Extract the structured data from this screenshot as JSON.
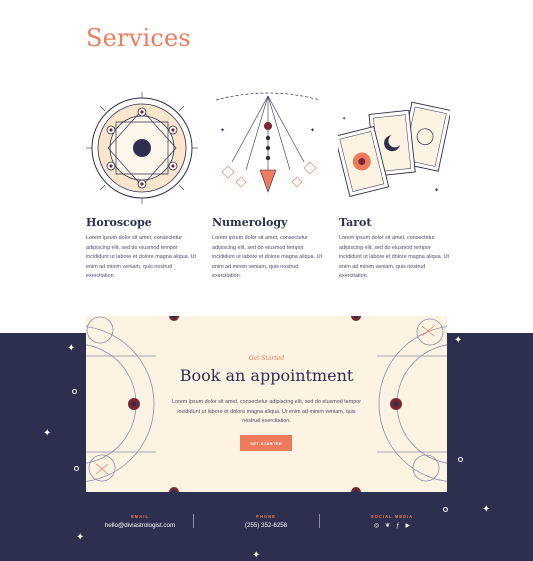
{
  "services": {
    "title": "Services",
    "items": [
      {
        "name": "Horoscope",
        "description": "Lorem ipsum dolor sit amet, consectetur adipiscing elit, sed do eiusmod tempor incididunt ut labore et dolore magna aliqua. Ut enim ad minim veniam, quis nostrud exercitation."
      },
      {
        "name": "Numerology",
        "description": "Lorem ipsum dolor sit amet, consectetur adipiscing elit, sed do eiusmod tempor incididunt ut labore et dolore magna aliqua. Ut enim ad minim veniam, quis nostrud exercitation."
      },
      {
        "name": "Tarot",
        "description": "Lorem ipsum dolor sit amet, consectetur adipiscing elit, sed do eiusmod tempor incididunt ut labore et dolore magna aliqua. Ut enim ad minim veniam, quis nostrud exercitation."
      }
    ]
  },
  "appointment": {
    "eyebrow": "Get Started",
    "title": "Book an appointment",
    "description": "Lorem ipsum dolor sit amet, consectetur adipiscing elit, sed do eiusmod tempor incididunt ut labore et dolore magna aliqua. Ut enim ad minim veniam, quis nostrud exercitation.",
    "button_label": "GET STARTED"
  },
  "footer": {
    "email": {
      "label": "EMAIL",
      "value": "hello@diviastrologist.com"
    },
    "phone": {
      "label": "PHONE",
      "value": "(255) 352-6258"
    },
    "social": {
      "label": "SOCIAL MEDIA",
      "icons": [
        "instagram-icon",
        "twitter-icon",
        "facebook-icon",
        "youtube-icon"
      ]
    }
  },
  "colors": {
    "accent": "#f07a5c",
    "navy": "#2d2f4e",
    "cream": "#fdf3e3"
  }
}
